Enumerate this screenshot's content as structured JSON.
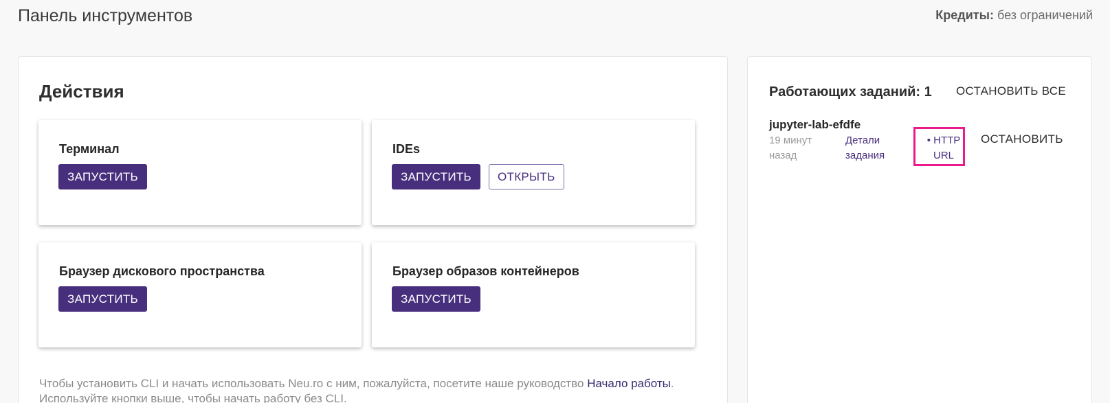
{
  "header": {
    "title": "Панель инструментов",
    "credits_label": "Кредиты:",
    "credits_value": "без ограничений"
  },
  "actions": {
    "title": "Действия",
    "cards": [
      {
        "title": "Терминал",
        "launch_label": "ЗАПУСТИТЬ"
      },
      {
        "title": "IDEs",
        "launch_label": "ЗАПУСТИТЬ",
        "open_label": "ОТКРЫТЬ"
      },
      {
        "title": "Браузер дискового пространства",
        "launch_label": "ЗАПУСТИТЬ"
      },
      {
        "title": "Браузер образов контейнеров",
        "launch_label": "ЗАПУСТИТЬ"
      }
    ],
    "cli_hint_before": "Чтобы установить CLI и начать использовать Neu.ro с ним, пожалуйста, посетите наше руководство ",
    "cli_hint_link": "Начало работы",
    "cli_hint_after": ". Используйте кнопки выше, чтобы начать работу без CLI."
  },
  "jobs": {
    "title": "Работающих заданий: 1",
    "stop_all_label": "ОСТАНОВИТЬ ВСЕ",
    "items": [
      {
        "name": "jupyter-lab-efdfe",
        "time": "19 минут назад",
        "details_label": "Детали задания",
        "http_label": "• HTTP URL",
        "stop_label": "ОСТАНОВИТЬ"
      }
    ]
  },
  "colors": {
    "primary": "#472f7e",
    "highlight": "#ea1a8c",
    "background": "#f8f8f9"
  }
}
